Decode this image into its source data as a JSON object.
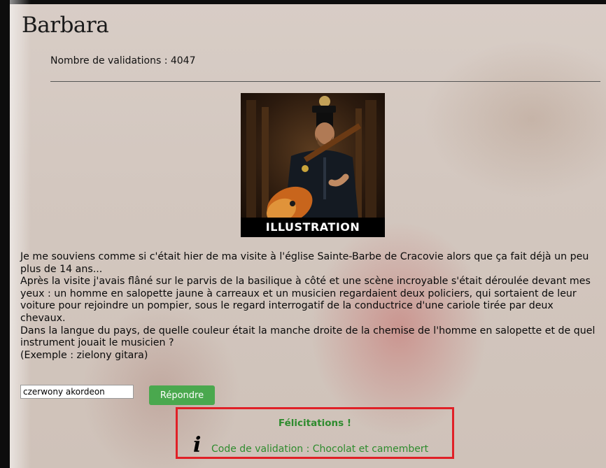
{
  "page": {
    "title": "Barbara",
    "validations_text": "Nombre de validations : 4047"
  },
  "illustration": {
    "caption": "ILLUSTRATION"
  },
  "story": {
    "paragraphs": [
      "Je me souviens comme si c'était hier de ma visite à l'église Sainte-Barbe de Cracovie alors que ça fait déjà un peu plus de 14 ans...",
      "Après la visite j'avais flâné sur le parvis de la basilique à côté et une scène incroyable s'était déroulée devant mes yeux : un homme en salopette jaune à carreaux et un musicien regardaient deux policiers, qui sortaient de leur voiture pour rejoindre un pompier, sous le regard interrogatif de la conductrice d'une cariole tirée par deux chevaux.",
      "Dans la langue du pays, de quelle couleur était la manche droite de la chemise de l'homme en salopette et de quel instrument jouait le musicien ?",
      "(Exemple : zielony gitara)"
    ]
  },
  "answer": {
    "value": "czerwony akordeon",
    "submit_label": "Répondre"
  },
  "result": {
    "title": "Félicitations !",
    "icon": "info-icon",
    "icon_glyph": "i",
    "code_text": "Code de validation : Chocolat et camembert"
  },
  "colors": {
    "button": "#4aa84e",
    "success_text": "#2e8b2e",
    "result_border": "#e02027"
  }
}
